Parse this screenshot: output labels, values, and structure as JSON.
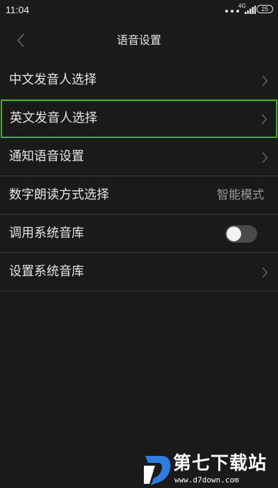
{
  "status_bar": {
    "time": "11:04",
    "network_type": "4G",
    "battery_level": "25",
    "icons": [
      "notification-dots-icon",
      "signal-icon",
      "battery-icon"
    ]
  },
  "header": {
    "title": "语音设置",
    "back_icon": "chevron-left-icon"
  },
  "settings": {
    "items": [
      {
        "label": "中文发音人选择",
        "control": "chevron",
        "icon": "chevron-right-icon"
      },
      {
        "label": "英文发音人选择",
        "control": "chevron",
        "icon": "chevron-right-icon",
        "highlighted": true
      },
      {
        "label": "通知语音设置",
        "control": "chevron",
        "icon": "chevron-right-icon"
      },
      {
        "label": "数字朗读方式选择",
        "control": "value",
        "value": "智能模式"
      },
      {
        "label": "调用系统音库",
        "control": "toggle",
        "toggle_on": false
      },
      {
        "label": "设置系统音库",
        "control": "chevron",
        "icon": "chevron-right-icon"
      }
    ]
  },
  "watermark": {
    "name": "第七下载站",
    "url": "www.d7down.com"
  },
  "colors": {
    "background": "#1a1a1a",
    "text": "#e6e6e6",
    "muted": "#9a9a9a",
    "divider": "#3a3a3a",
    "highlight": "#4caf1e",
    "watermark_blue": "#2f7de1"
  }
}
